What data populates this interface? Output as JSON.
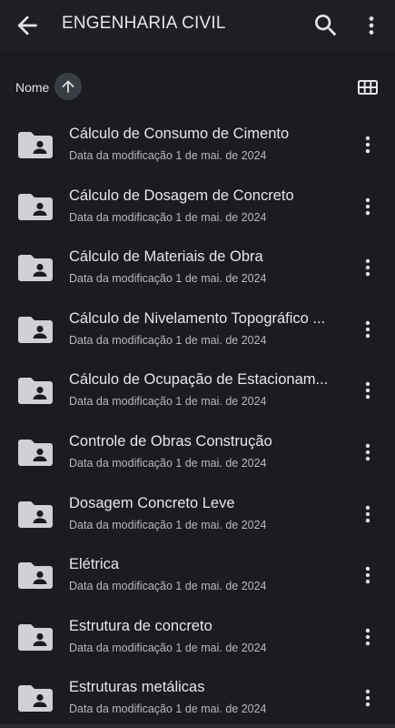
{
  "header": {
    "title": "ENGENHARIA CIVIL",
    "back_icon": "arrow-back-icon",
    "search_icon": "search-icon",
    "more_icon": "more-vert-icon"
  },
  "sort": {
    "label": "Nome",
    "direction_icon": "arrow-up-icon",
    "view_icon": "grid-view-icon"
  },
  "colors": {
    "background": "#1b1c20",
    "text": "#e6e6ea",
    "secondary_text": "#b7b8bd",
    "folder_icon": "#d0d1d6",
    "sort_button": "#3a3d44"
  },
  "items": [
    {
      "name": "Cálculo de Consumo de Cimento",
      "meta": "Data da modificação 1 de mai. de 2024"
    },
    {
      "name": "Cálculo de Dosagem de Concreto",
      "meta": "Data da modificação 1 de mai. de 2024"
    },
    {
      "name": "Cálculo de Materiais de Obra",
      "meta": "Data da modificação 1 de mai. de 2024"
    },
    {
      "name": "Cálculo de Nivelamento Topográfico ...",
      "meta": "Data da modificação 1 de mai. de 2024"
    },
    {
      "name": "Cálculo de Ocupação de Estacionam...",
      "meta": "Data da modificação 1 de mai. de 2024"
    },
    {
      "name": "Controle de Obras Construção",
      "meta": "Data da modificação 1 de mai. de 2024"
    },
    {
      "name": "Dosagem Concreto Leve",
      "meta": "Data da modificação 1 de mai. de 2024"
    },
    {
      "name": "Elétrica",
      "meta": "Data da modificação 1 de mai. de 2024"
    },
    {
      "name": "Estrutura de concreto",
      "meta": "Data da modificação 1 de mai. de 2024"
    },
    {
      "name": "Estruturas metálicas",
      "meta": "Data da modificação 1 de mai. de 2024"
    }
  ]
}
